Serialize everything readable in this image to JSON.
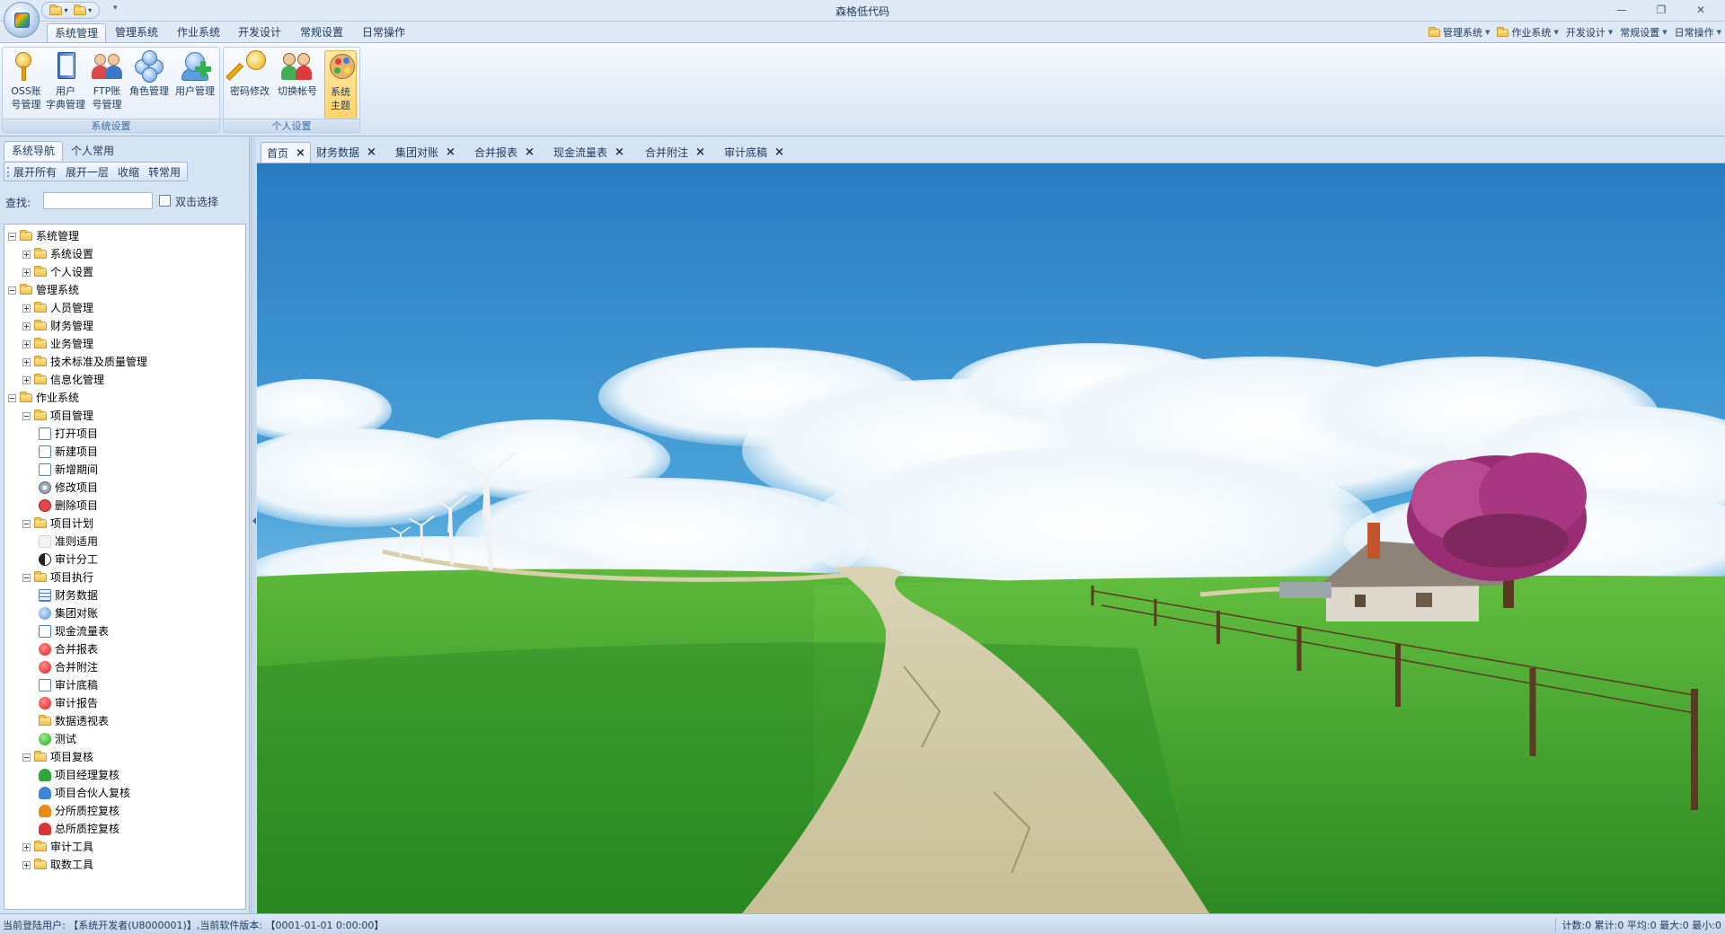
{
  "app": {
    "title": "森格低代码"
  },
  "ribbon": {
    "tabs": [
      "系统管理",
      "管理系统",
      "作业系统",
      "开发设计",
      "常规设置",
      "日常操作"
    ],
    "right_menu": [
      "管理系统",
      "作业系统",
      "开发设计",
      "常规设置",
      "日常操作"
    ],
    "groups": [
      {
        "label": "系统设置",
        "buttons": [
          {
            "label": "OSS账\n号管理",
            "icon": "key-user-icon"
          },
          {
            "label": "用户\n字典管理",
            "icon": "book-icon"
          },
          {
            "label": "FTP账\n号管理",
            "icon": "people-icon"
          },
          {
            "label": "角色管理",
            "icon": "roles-icon"
          },
          {
            "label": "用户管理",
            "icon": "user-add-icon"
          }
        ]
      },
      {
        "label": "个人设置",
        "buttons": [
          {
            "label": "密码修改",
            "icon": "key-icon"
          },
          {
            "label": "切换帐号",
            "icon": "switch-user-icon"
          },
          {
            "label": "系统\n主题",
            "icon": "palette-icon"
          }
        ]
      }
    ]
  },
  "left_panel": {
    "tabs": [
      "系统导航",
      "个人常用"
    ],
    "toolbar": [
      "展开所有",
      "展开一层",
      "收缩",
      "转常用"
    ],
    "search_label": "查找:",
    "search_value": "",
    "double_click_label": "双击选择",
    "tree": [
      {
        "label": "系统管理",
        "level": 0,
        "type": "folder",
        "expanded": true
      },
      {
        "label": "系统设置",
        "level": 1,
        "type": "folder",
        "expanded": false
      },
      {
        "label": "个人设置",
        "level": 1,
        "type": "folder",
        "expanded": false
      },
      {
        "label": "管理系统",
        "level": 0,
        "type": "folder",
        "expanded": true
      },
      {
        "label": "人员管理",
        "level": 1,
        "type": "folder",
        "expanded": false
      },
      {
        "label": "财务管理",
        "level": 1,
        "type": "folder",
        "expanded": false
      },
      {
        "label": "业务管理",
        "level": 1,
        "type": "folder",
        "expanded": false
      },
      {
        "label": "技术标准及质量管理",
        "level": 1,
        "type": "folder",
        "expanded": false
      },
      {
        "label": "信息化管理",
        "level": 1,
        "type": "folder",
        "expanded": false
      },
      {
        "label": "作业系统",
        "level": 0,
        "type": "folder",
        "expanded": true
      },
      {
        "label": "项目管理",
        "level": 1,
        "type": "folder",
        "expanded": true
      },
      {
        "label": "打开项目",
        "level": 2,
        "type": "doc"
      },
      {
        "label": "新建项目",
        "level": 2,
        "type": "doc"
      },
      {
        "label": "新增期间",
        "level": 2,
        "type": "doc"
      },
      {
        "label": "修改项目",
        "level": 2,
        "type": "gear"
      },
      {
        "label": "删除项目",
        "level": 2,
        "type": "del"
      },
      {
        "label": "项目计划",
        "level": 1,
        "type": "folder",
        "expanded": true
      },
      {
        "label": "准则适用",
        "level": 2,
        "type": "blank"
      },
      {
        "label": "审计分工",
        "level": 2,
        "type": "yinyang"
      },
      {
        "label": "项目执行",
        "level": 1,
        "type": "folder",
        "expanded": true
      },
      {
        "label": "财务数据",
        "level": 2,
        "type": "grid"
      },
      {
        "label": "集团对账",
        "level": 2,
        "type": "people"
      },
      {
        "label": "现金流量表",
        "level": 2,
        "type": "chart"
      },
      {
        "label": "合并报表",
        "level": 2,
        "type": "red"
      },
      {
        "label": "合并附注",
        "level": 2,
        "type": "red"
      },
      {
        "label": "审计底稿",
        "level": 2,
        "type": "doc"
      },
      {
        "label": "审计报告",
        "level": 2,
        "type": "red"
      },
      {
        "label": "数据透视表",
        "level": 2,
        "type": "folder"
      },
      {
        "label": "测试",
        "level": 2,
        "type": "green"
      },
      {
        "label": "项目复核",
        "level": 1,
        "type": "folder",
        "expanded": true
      },
      {
        "label": "项目经理复核",
        "level": 2,
        "type": "user-green"
      },
      {
        "label": "项目合伙人复核",
        "level": 2,
        "type": "user-blue"
      },
      {
        "label": "分所质控复核",
        "level": 2,
        "type": "user-orange"
      },
      {
        "label": "总所质控复核",
        "level": 2,
        "type": "user-red"
      },
      {
        "label": "审计工具",
        "level": 1,
        "type": "folder",
        "expanded": false
      },
      {
        "label": "取数工具",
        "level": 1,
        "type": "folder",
        "expanded": false
      }
    ]
  },
  "doc_tabs": [
    "首页",
    "财务数据",
    "集团对账",
    "合并报表",
    "现金流量表",
    "合并附注",
    "审计底稿"
  ],
  "status": {
    "left": "当前登陆用户: 【系统开发者(U8000001)】,当前软件版本: 【0001-01-01 0:00:00】",
    "right": "计数:0 累计:0 平均:0 最大:0 最小:0"
  },
  "colors": {
    "ribbon_bg": "#dfe9f5",
    "accent": "#3e6aa1",
    "sky_top": "#2d7fc4",
    "grass": "#3e9b2c"
  }
}
